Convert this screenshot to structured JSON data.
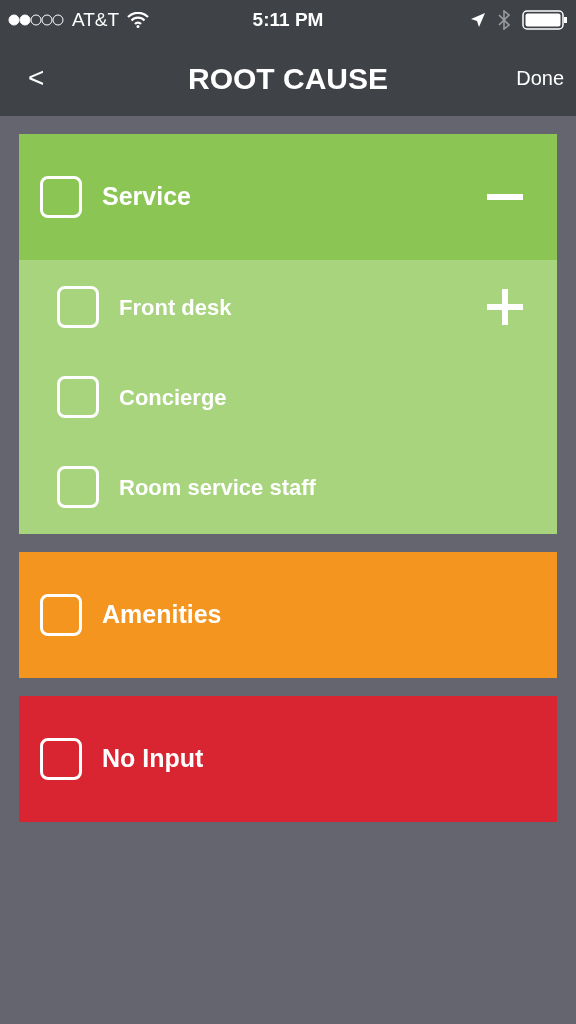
{
  "status_bar": {
    "carrier": "AT&T",
    "time": "5:11 PM"
  },
  "nav": {
    "back": "<",
    "title": "ROOT CAUSE",
    "done": "Done"
  },
  "categories": [
    {
      "label": "Service",
      "color": "#8bc553",
      "checked": false,
      "expanded": true,
      "children": [
        {
          "label": "Front desk",
          "checked": false,
          "expanded": false
        },
        {
          "label": "Concierge",
          "checked": false
        },
        {
          "label": "Room service staff",
          "checked": false
        }
      ]
    },
    {
      "label": "Amenities",
      "color": "#f4951f",
      "checked": false
    },
    {
      "label": "No Input",
      "color": "#d92532",
      "checked": false
    }
  ]
}
